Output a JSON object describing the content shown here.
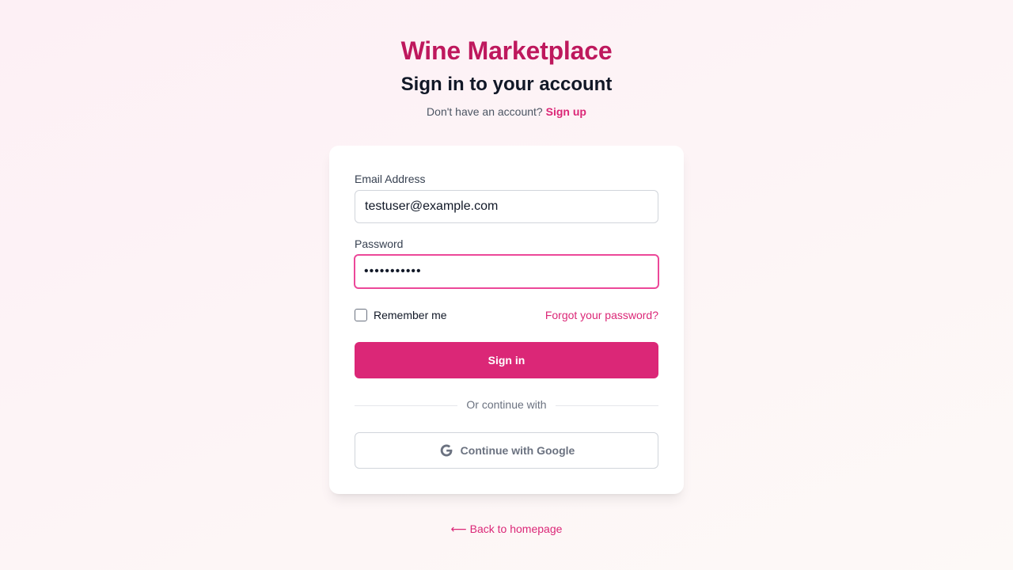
{
  "brand": "Wine Marketplace",
  "heading": "Sign in to your account",
  "signup_prompt": {
    "text": "Don't have an account?",
    "link": "Sign up"
  },
  "form": {
    "email": {
      "label": "Email Address",
      "value": "testuser@example.com"
    },
    "password": {
      "label": "Password",
      "value": "•••••••••••"
    },
    "remember_label": "Remember me",
    "remember_checked": false,
    "forgot_label": "Forgot your password?",
    "submit_label": "Sign in",
    "divider_text": "Or continue with",
    "google_label": "Continue with Google"
  },
  "back_link": {
    "arrow": "⟵",
    "label": "Back to homepage"
  },
  "colors": {
    "brand": "#be185d",
    "accent": "#db2777",
    "focus_ring": "#ec4899",
    "heading": "#111827",
    "muted": "#6b7280"
  },
  "icons": {
    "google": "google-icon",
    "back": "arrow-left-icon"
  }
}
